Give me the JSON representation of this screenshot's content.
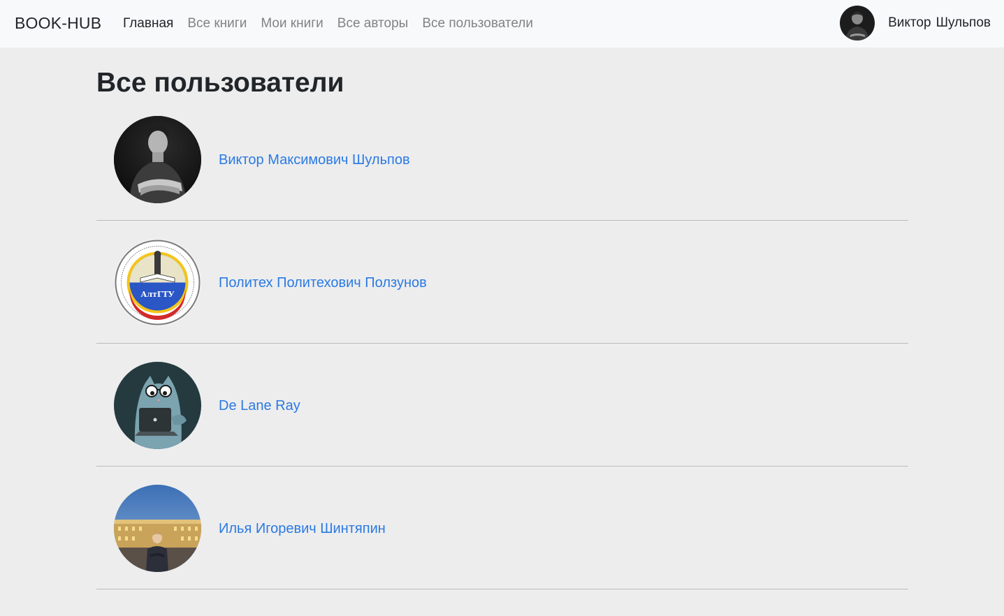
{
  "navbar": {
    "brand": "BOOK-HUB",
    "links": [
      "Главная",
      "Все книги",
      "Мои книги",
      "Все авторы",
      "Все пользователи"
    ],
    "user_first": "Виктор",
    "user_last": "Шульпов"
  },
  "page": {
    "title": "Все пользователи"
  },
  "users": [
    {
      "name": "Виктор Максимович Шульпов",
      "avatar": "person-bw-photo"
    },
    {
      "name": "Политех Политехович Ползунов",
      "avatar": "altgtu-emblem"
    },
    {
      "name": "De Lane Ray",
      "avatar": "cat-with-laptop-illustration"
    },
    {
      "name": "Илья Игоревич Шинтяпин",
      "avatar": "person-at-palace-night-photo"
    }
  ],
  "emblem": {
    "text": "АлтГТУ"
  },
  "colors": {
    "link": "#2a7ae2",
    "navbar_bg": "#f8f9fa",
    "page_bg": "#ededee"
  }
}
